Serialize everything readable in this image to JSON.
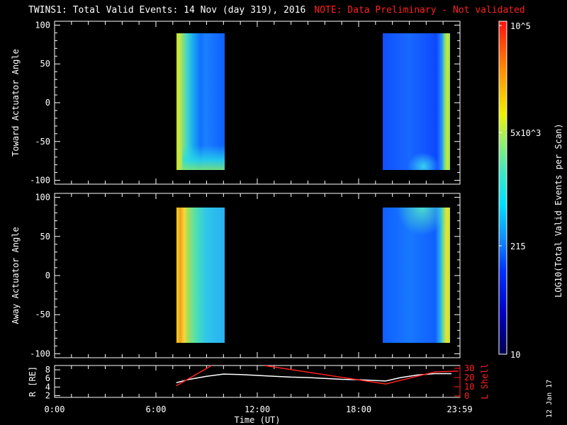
{
  "title": {
    "main": "TWINS1: Total Valid Events: 14 Nov (day 319), 2016",
    "note": "NOTE: Data Preliminary - Not validated"
  },
  "date_stamp": "12 Jan 17",
  "colorbar": {
    "label": "LOG10(Total Valid Events per Scan)",
    "ticks": [
      "10^5",
      "5x10^3",
      "215",
      "10"
    ]
  },
  "chart_data": [
    {
      "type": "heatmap",
      "name": "toward",
      "ylabel": "Toward Actuator Angle",
      "ylim": [
        -105,
        105
      ],
      "yticks": [
        100,
        50,
        0,
        -50,
        -100
      ],
      "xlim": [
        0,
        24
      ],
      "data_intervals_hours": [
        [
          7.2,
          10.05
        ],
        [
          19.4,
          23.65
        ]
      ],
      "angle_range": [
        -88,
        90
      ]
    },
    {
      "type": "heatmap",
      "name": "away",
      "ylabel": "Away Actuator Angle",
      "ylim": [
        -105,
        105
      ],
      "yticks": [
        100,
        50,
        0,
        -50,
        -100
      ],
      "xlim": [
        0,
        24
      ],
      "data_intervals_hours": [
        [
          7.2,
          10.05
        ],
        [
          19.4,
          23.65
        ]
      ],
      "angle_range": [
        -88,
        90
      ]
    },
    {
      "type": "line",
      "name": "orbit",
      "ylabel": "R [RE]",
      "y2label": "L Shell",
      "xlabel": "Time (UT)",
      "xticklabels": [
        "0:00",
        "6:00",
        "12:00",
        "18:00",
        "23:59"
      ],
      "xticks": [
        0,
        6,
        12,
        18,
        23.98
      ],
      "yticks": [
        2,
        4,
        6,
        8
      ],
      "ylim": [
        1.6,
        9.0
      ],
      "y2ticks": [
        0,
        10,
        20,
        30
      ],
      "y2lim": [
        -1.5,
        33
      ],
      "series": [
        {
          "name": "R",
          "color": "#ffffff",
          "x": [
            7.2,
            8,
            9,
            10,
            11,
            12,
            13,
            14,
            15,
            16,
            17,
            18,
            19,
            19.6,
            20.5,
            21.5,
            22.5,
            23.5
          ],
          "y": [
            5.0,
            5.8,
            6.5,
            7.0,
            6.9,
            6.7,
            6.5,
            6.3,
            6.2,
            6.0,
            5.8,
            5.7,
            5.5,
            5.4,
            6.2,
            6.8,
            7.1,
            7.1
          ]
        },
        {
          "name": "L Shell",
          "color": "#ff2020",
          "axis": "right",
          "x": [
            7.2,
            9.3
          ],
          "y": [
            11,
            33
          ]
        },
        {
          "name": "L Shell",
          "color": "#ff2020",
          "axis": "right",
          "x": [
            12.4,
            19.6,
            22.5,
            23.9
          ],
          "y": [
            33,
            13,
            26,
            27
          ]
        }
      ]
    }
  ]
}
